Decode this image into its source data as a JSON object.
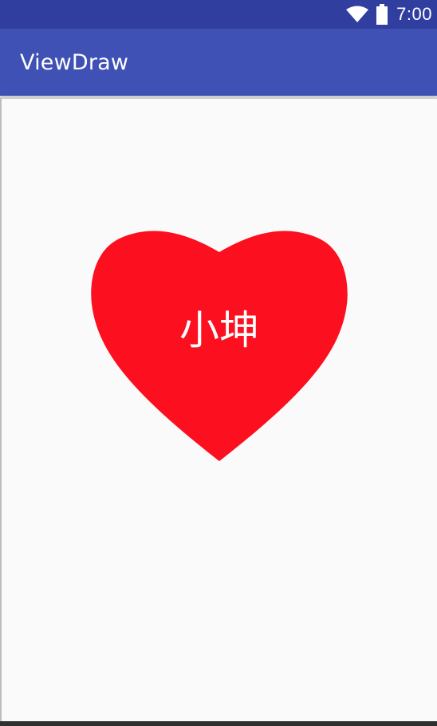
{
  "status_bar": {
    "time": "7:00",
    "icons": [
      "wifi-icon",
      "battery-icon"
    ]
  },
  "app_bar": {
    "title": "ViewDraw"
  },
  "canvas": {
    "heart_label": "小坤",
    "heart_color": "#fc0f1e",
    "label_color": "#ffffff"
  },
  "colors": {
    "primary": "#3f51b5",
    "primary_dark": "#303f9f",
    "background": "#fafafa"
  }
}
